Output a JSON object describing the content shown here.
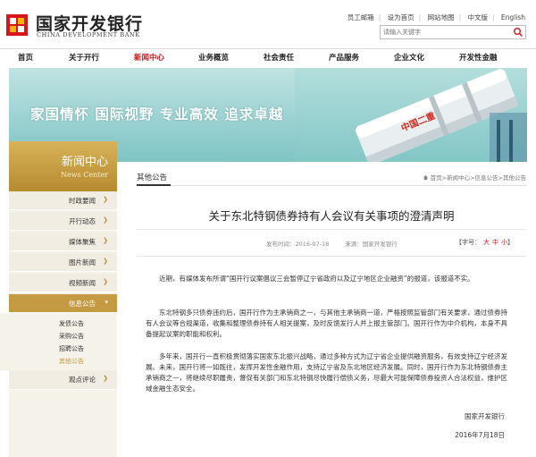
{
  "header": {
    "logo_cn": "国家开发银行",
    "logo_en": "CHINA DEVELOPMENT BANK",
    "links": [
      "员工邮箱",
      "设为首页",
      "网站地图",
      "中文版",
      "English"
    ],
    "search_placeholder": "请输入关键字"
  },
  "nav": {
    "items": [
      "首页",
      "关于开行",
      "新闻中心",
      "业务概览",
      "社会责任",
      "产品服务",
      "企业文化",
      "开发性金融"
    ],
    "active": "新闻中心"
  },
  "banner": {
    "slogan": "家国情怀  国际视野  专业高效  追求卓越",
    "art_text": "中国二重"
  },
  "sidebar": {
    "title": "新闻中心",
    "subtitle": "News Center",
    "items": [
      "时政要闻",
      "开行动态",
      "媒体聚焦",
      "图片新闻",
      "视频新闻",
      "信息公告",
      "观点评论"
    ],
    "active": "信息公告",
    "sub_items": [
      "发债公告",
      "采购公告",
      "招聘公告",
      "其他公告"
    ],
    "sub_active": "其他公告"
  },
  "main": {
    "tab": "其他公告",
    "breadcrumb": "首页>新闻中心>信息公告>其他公告",
    "title": "关于东北特钢债券持有人会议有关事项的澄清声明",
    "publish_time": "发布时间：2016-07-18",
    "source": "来源：国家开发银行",
    "font_size_label": "【字号：",
    "font_sizes": [
      "大",
      "中",
      "小"
    ],
    "font_size_close": "】",
    "paragraphs": [
      "近期，有媒体发布所谓“国开行议案倡议三会暂停辽宁省政府以及辽宁地区企业融资”的报道，该报道不实。",
      "东北特钢多只债券违约后，国开行作为主承销商之一，与其他主承销商一道，严格按照监管部门有关要求，通过债券持有人会议等合规渠道，收集和整理债券持有人相关提案，及时反馈发行人并上报主管部门。国开行作为中介机构，本身不具备提起议案的职能和权利。",
      "多年来，国开行一直积极贯彻落实国家东北振兴战略，通过多种方式为辽宁省企业提供融资服务，有效支持辽宁经济发展。未来，国开行将一如既往，发挥开发性金融作用，支持辽宁省及东北地区经济发展。同时，国开行作为东北特钢债券主承销商之一，将继续尽职履责，督促有关部门和东北特钢尽快履行偿债义务，尽最大可能保障债券投资人合法权益，维护区域金融生态安全。"
    ],
    "signature": "国家开发银行",
    "date": "2016年7月18日"
  },
  "colors": {
    "brand_red": "#c8171e",
    "gold": "#c49a43",
    "banner_teal": "#7fc4c4"
  }
}
